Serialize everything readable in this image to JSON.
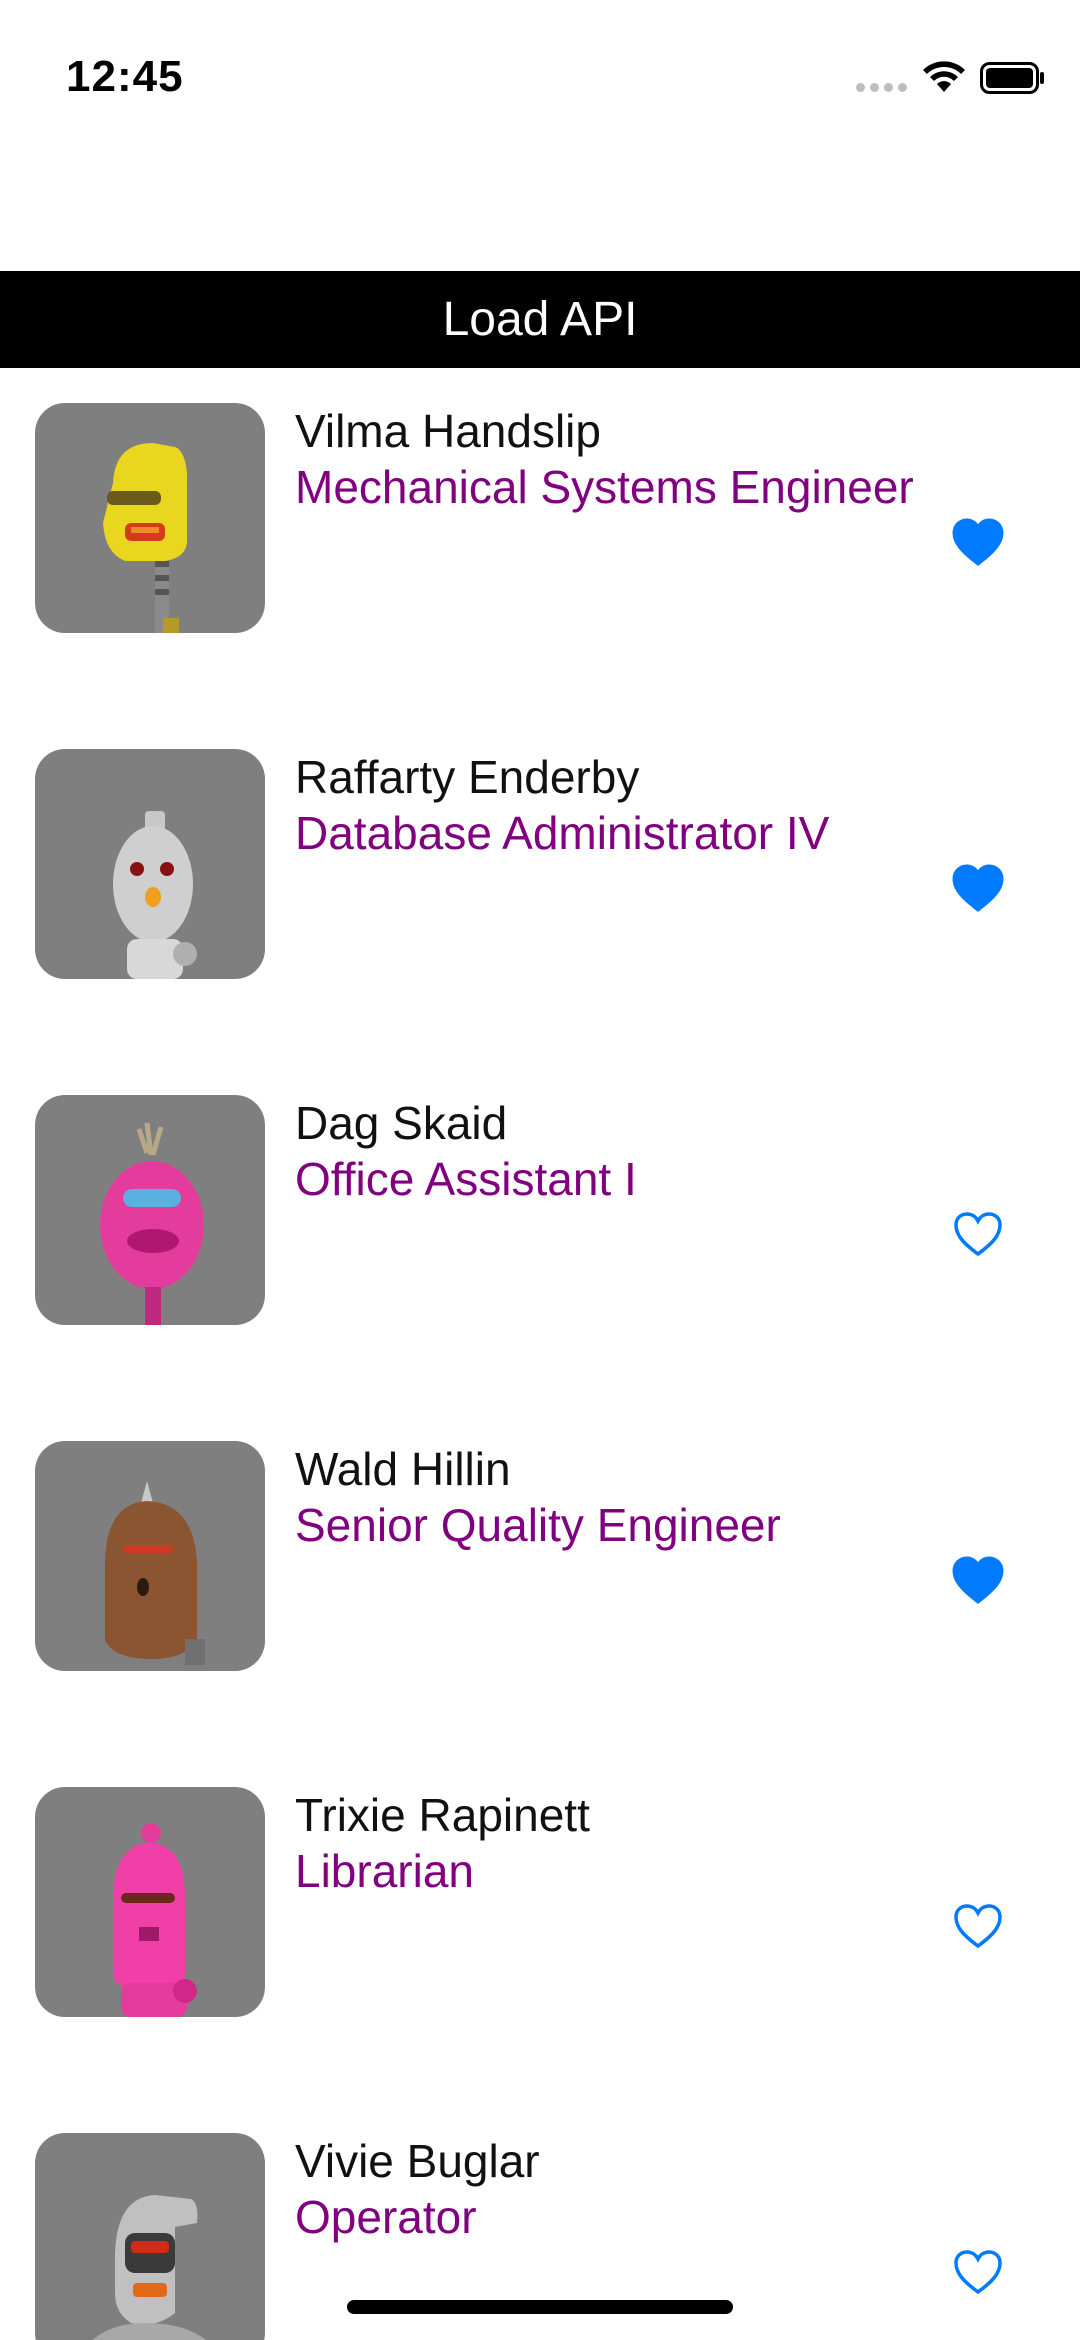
{
  "status_bar": {
    "time": "12:45"
  },
  "header": {
    "button_label": "Load API"
  },
  "accent_colors": {
    "header_bg": "#000000",
    "job_title": "#800080",
    "heart": "#007AFF",
    "avatar_bg": "#7f7f7f"
  },
  "people": [
    {
      "name": "Vilma Handslip",
      "job": "Mechanical Systems Engineer",
      "favorite": true,
      "avatar_icon": "yellow-robot-icon"
    },
    {
      "name": "Raffarty Enderby",
      "job": "Database Administrator IV",
      "favorite": true,
      "avatar_icon": "silver-robot-icon"
    },
    {
      "name": "Dag Skaid",
      "job": "Office Assistant I",
      "favorite": false,
      "avatar_icon": "pink-robot-icon"
    },
    {
      "name": "Wald Hillin",
      "job": "Senior Quality Engineer",
      "favorite": true,
      "avatar_icon": "brown-robot-icon"
    },
    {
      "name": "Trixie Rapinett",
      "job": "Librarian",
      "favorite": false,
      "avatar_icon": "pink-robot-icon"
    },
    {
      "name": "Vivie Buglar",
      "job": "Operator",
      "favorite": false,
      "avatar_icon": "gray-robot-icon"
    }
  ]
}
